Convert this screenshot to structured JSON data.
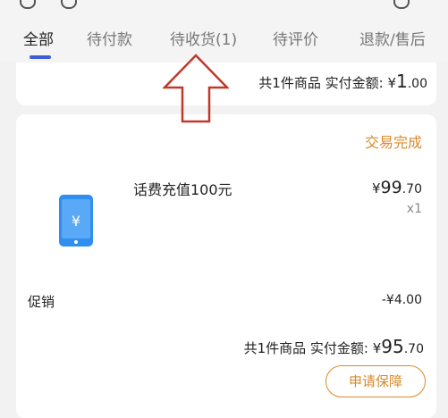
{
  "tabs": [
    {
      "label": "全部",
      "active": true
    },
    {
      "label": "待付款",
      "active": false
    },
    {
      "label": "待收货(1)",
      "active": false
    },
    {
      "label": "待评价",
      "active": false
    },
    {
      "label": "退款/售后",
      "active": false
    }
  ],
  "order1": {
    "summary_prefix": "共1件商品 实付金额:",
    "currency": "¥",
    "amount_int": "1",
    "amount_dec": ".00"
  },
  "order2": {
    "status": "交易完成",
    "product_name": "话费充值100元",
    "currency": "¥",
    "price_int": "99",
    "price_dec": ".70",
    "qty": "x1",
    "promo_label": "促销",
    "promo_value": "-¥4.00",
    "summary_prefix": "共1件商品 实付金额:",
    "amount_int": "95",
    "amount_dec": ".70",
    "button_label": "申请保障"
  },
  "colors": {
    "accent_orange": "#d98a2b",
    "tab_indicator": "#3a5fd9",
    "arrow_red": "#c0392b",
    "icon_blue": "#2f8ef0"
  },
  "icons": {
    "product": "phone-recharge-icon",
    "annotation": "up-arrow-icon"
  }
}
